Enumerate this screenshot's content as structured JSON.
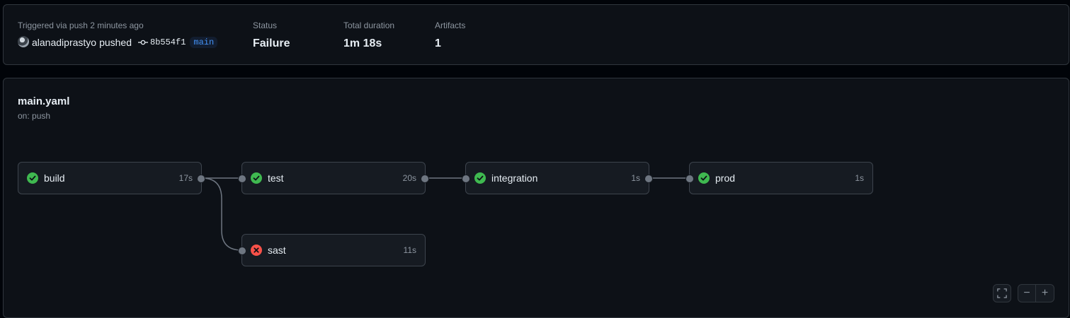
{
  "summary": {
    "trigger_text": "Triggered via push 2 minutes ago",
    "actor": "alanadiprastyo",
    "action": "pushed",
    "commit_sha": "8b554f1",
    "branch": "main",
    "status_label": "Status",
    "status_value": "Failure",
    "duration_label": "Total duration",
    "duration_value": "1m 18s",
    "artifacts_label": "Artifacts",
    "artifacts_value": "1"
  },
  "workflow": {
    "name": "main.yaml",
    "trigger": "on: push",
    "jobs": [
      {
        "name": "build",
        "duration": "17s",
        "status": "success"
      },
      {
        "name": "test",
        "duration": "20s",
        "status": "success"
      },
      {
        "name": "integration",
        "duration": "1s",
        "status": "success"
      },
      {
        "name": "prod",
        "duration": "1s",
        "status": "success"
      },
      {
        "name": "sast",
        "duration": "11s",
        "status": "failure"
      }
    ]
  },
  "controls": {
    "fullscreen_icon": "fullscreen-icon",
    "zoom_out_label": "−",
    "zoom_in_label": "+"
  },
  "colors": {
    "success": "#3fb950",
    "failure": "#f85149",
    "accent": "#4493f8"
  }
}
